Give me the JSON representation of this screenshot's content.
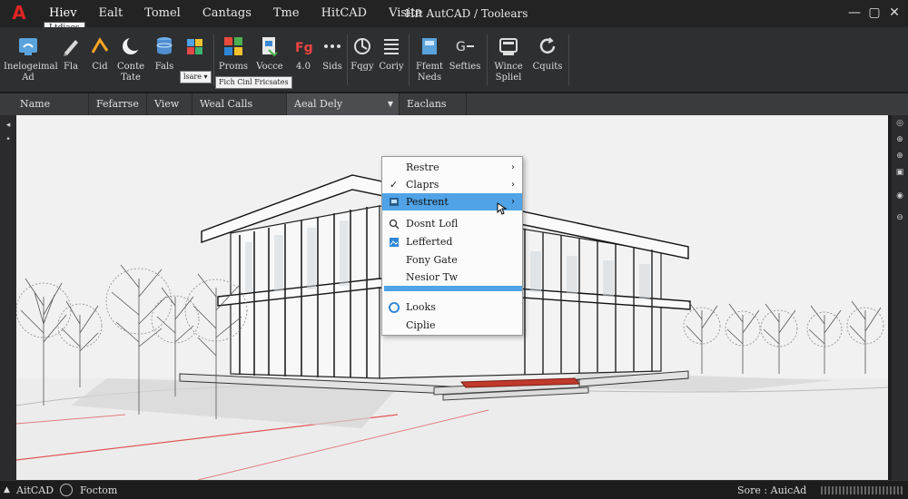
{
  "titlebar": {
    "logo": "A",
    "menu": [
      "Hiev",
      "Ealt",
      "Tomel",
      "Cantags",
      "Tme",
      "HitCAD",
      "Visite"
    ],
    "tooltip": "Ltdiaes",
    "window_title": "Hft AutCAD / Toolears",
    "controls": [
      "—",
      "▢",
      "✕"
    ]
  },
  "ribbon": {
    "tools": [
      {
        "icon": "workspace-icon",
        "label": "Inelogeimal\nAd"
      },
      {
        "icon": "pencil-icon",
        "label": "Fla"
      },
      {
        "icon": "arc-icon",
        "label": "Cid"
      },
      {
        "icon": "moon-icon",
        "label": "Conte\nTate"
      },
      {
        "icon": "database-icon",
        "label": "Fals"
      },
      {
        "icon": "palette-icon",
        "label": ""
      },
      {
        "icon": "grid-icon",
        "label": "Proms"
      },
      {
        "icon": "document-icon",
        "label": "Vocce"
      },
      {
        "icon": "format-icon",
        "label": "4.0"
      },
      {
        "icon": "more-icon",
        "label": "Sids"
      },
      {
        "icon": "rotate-icon",
        "label": "Fqgy"
      },
      {
        "icon": "list-icon",
        "label": "Coriy"
      },
      {
        "icon": "frame-icon",
        "label": "Ffemt\nNeds"
      },
      {
        "icon": "link-icon",
        "label": "Sefties"
      },
      {
        "icon": "window-icon",
        "label": "Wince\nSpliel"
      },
      {
        "icon": "refresh-icon",
        "label": "Cquits"
      }
    ],
    "mini_buttons": [
      "lsare ▾",
      "Fich Cinl Fricsates"
    ]
  },
  "propbar": {
    "items": [
      "Name",
      "Fefarrse",
      "View",
      "Weal Calls Flegres",
      "Aeal Dely",
      "Eaclans"
    ]
  },
  "context_menu": {
    "items": [
      {
        "label": "Restre",
        "arrow": "›"
      },
      {
        "label": "Claprs",
        "arrow": "›",
        "check": "✓"
      },
      {
        "label": "Pestrent",
        "arrow": "›",
        "highlighted": true
      },
      {
        "label": "Dosnt Lofl"
      },
      {
        "label": "Lefferted"
      },
      {
        "label": "Fony Gate"
      },
      {
        "label": "Nesior Tw"
      },
      {
        "label": "Looks"
      },
      {
        "label": "Ciplie"
      }
    ]
  },
  "status": {
    "left_logo": "▲",
    "left_label": "AitCAD",
    "mid_label": "Foctom",
    "right_label": "Sore : AuicAd"
  },
  "colors": {
    "accent": "#e02424",
    "highlight": "#4fa3e6",
    "canvas": "#f1f1f1",
    "base": "#d11f1f"
  }
}
